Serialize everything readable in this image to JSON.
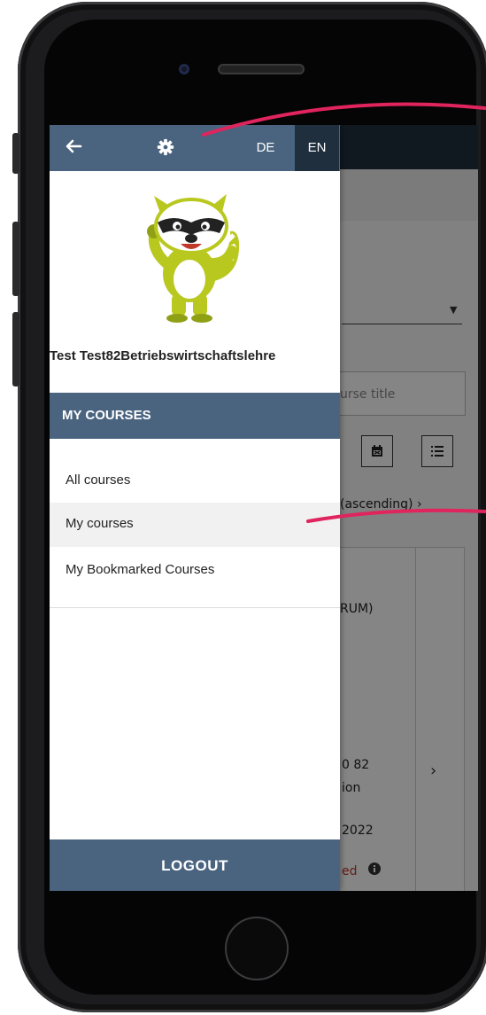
{
  "drawer": {
    "languages": {
      "de": "DE",
      "en": "EN"
    },
    "user_name": "Test Test82Betriebswirtschaftslehre",
    "section_title": "MY COURSES",
    "menu_items": [
      {
        "label": "All courses"
      },
      {
        "label": "My courses"
      },
      {
        "label": "My Bookmarked Courses"
      }
    ],
    "logout_label": "LOGOUT"
  },
  "background_app": {
    "search_placeholder_partial": "urse title",
    "sort_partial": "(ascending) ›",
    "card_lines": {
      "line1": "RUM)",
      "line2": "0 82",
      "line3": "ion",
      "line4": "2022",
      "status_partial": "ed"
    }
  },
  "icons": {
    "back": "arrow-left-icon",
    "settings": "gear-icon",
    "calendar": "calendar-icon",
    "list": "list-icon",
    "info": "info-icon",
    "chevron": "chevron-right-icon"
  },
  "colors": {
    "drawer_header": "#4a6480",
    "app_header": "#1f2f3e",
    "annotation_arrow": "#e0245e"
  }
}
